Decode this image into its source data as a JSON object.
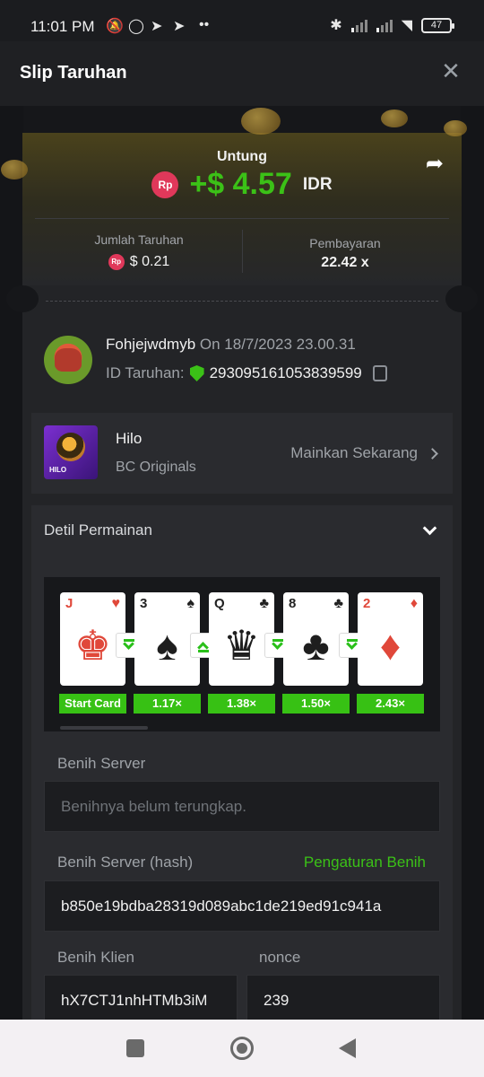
{
  "status_bar": {
    "time": "11:01 PM",
    "battery": "47"
  },
  "header": {
    "title": "Slip Taruhan",
    "close_label": "✕"
  },
  "summary": {
    "profit_label": "Untung",
    "currency_badge": "Rp",
    "profit_value": "+$ 4.57",
    "currency": "IDR",
    "bet_amount_label": "Jumlah Taruhan",
    "bet_amount": "$ 0.21",
    "payout_label": "Pembayaran",
    "payout": "22.42 x"
  },
  "bet_info": {
    "username": "Fohjejwdmyb",
    "date_text": "On 18/7/2023 23.00.31",
    "bet_id_label": "ID Taruhan:",
    "bet_id": "293095161053839599"
  },
  "game": {
    "name": "Hilo",
    "provider": "BC Originals",
    "thumb_label": "HILO",
    "play_label": "Mainkan Sekarang"
  },
  "details": {
    "title": "Detil Permainan",
    "cards": [
      {
        "rank": "J",
        "suit": "♥",
        "red": true,
        "multiplier": "Start Card",
        "guess": "down"
      },
      {
        "rank": "3",
        "suit": "♠",
        "red": false,
        "multiplier": "1.17×",
        "guess": "up"
      },
      {
        "rank": "Q",
        "suit": "♣",
        "red": false,
        "multiplier": "1.38×",
        "guess": "down"
      },
      {
        "rank": "8",
        "suit": "♣",
        "red": false,
        "multiplier": "1.50×",
        "guess": "down"
      },
      {
        "rank": "2",
        "suit": "♦",
        "red": true,
        "multiplier": "2.43×",
        "guess": ""
      }
    ],
    "server_seed_label": "Benih Server",
    "server_seed_value": "Benihnya belum terungkap.",
    "server_hash_label": "Benih Server (hash)",
    "seed_settings_link": "Pengaturan Benih",
    "server_hash_value": "b850e19bdba28319d089abc1de219ed91c941a",
    "client_seed_label": "Benih Klien",
    "client_seed_value": "hX7CTJ1nhHTMb3iM",
    "nonce_label": "nonce",
    "nonce_value": "239"
  },
  "colors": {
    "profit_green": "#3bc117",
    "rp_badge": "#e0385a"
  }
}
